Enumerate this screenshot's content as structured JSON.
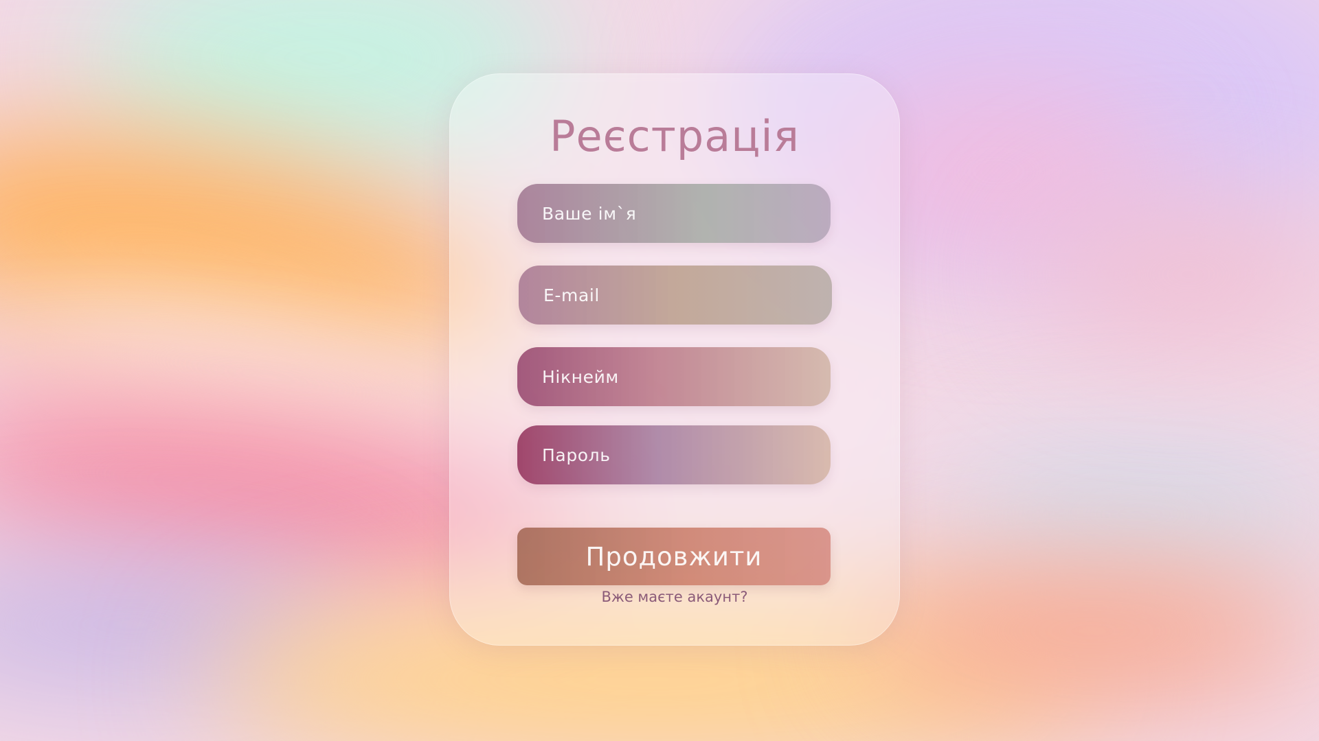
{
  "form": {
    "title": "Реєстрація",
    "fields": [
      {
        "placeholder": "Ваше ім`я"
      },
      {
        "placeholder": "E-mail"
      },
      {
        "placeholder": "Нікнейм"
      },
      {
        "placeholder": "Пароль"
      }
    ],
    "submit_label": "Продовжити",
    "login_link": "Вже маєте акаунт?"
  },
  "colors": {
    "title": "#b97c98",
    "link": "#8a5a78",
    "background_tones": [
      "#ffb45a",
      "#c8f0e4",
      "#dccaf4",
      "#f59aa8",
      "#ffd08a"
    ]
  }
}
